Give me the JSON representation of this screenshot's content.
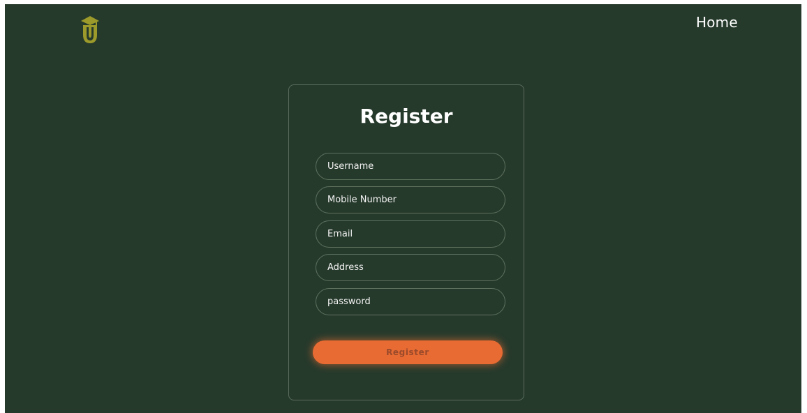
{
  "colors": {
    "background": "#263a2c",
    "accent": "#e86b33",
    "logo": "#9c9a2a",
    "text": "#ffffff"
  },
  "header": {
    "logo_icon": "graduation-cap-shield-logo",
    "nav": {
      "home_label": "Home"
    }
  },
  "form": {
    "title": "Register",
    "fields": [
      {
        "name": "username",
        "placeholder": "Username",
        "value": ""
      },
      {
        "name": "mobile",
        "placeholder": "Mobile Number",
        "value": ""
      },
      {
        "name": "email",
        "placeholder": "Email",
        "value": ""
      },
      {
        "name": "address",
        "placeholder": "Address",
        "value": ""
      },
      {
        "name": "password",
        "placeholder": "password",
        "value": ""
      }
    ],
    "submit_label": "Register"
  }
}
